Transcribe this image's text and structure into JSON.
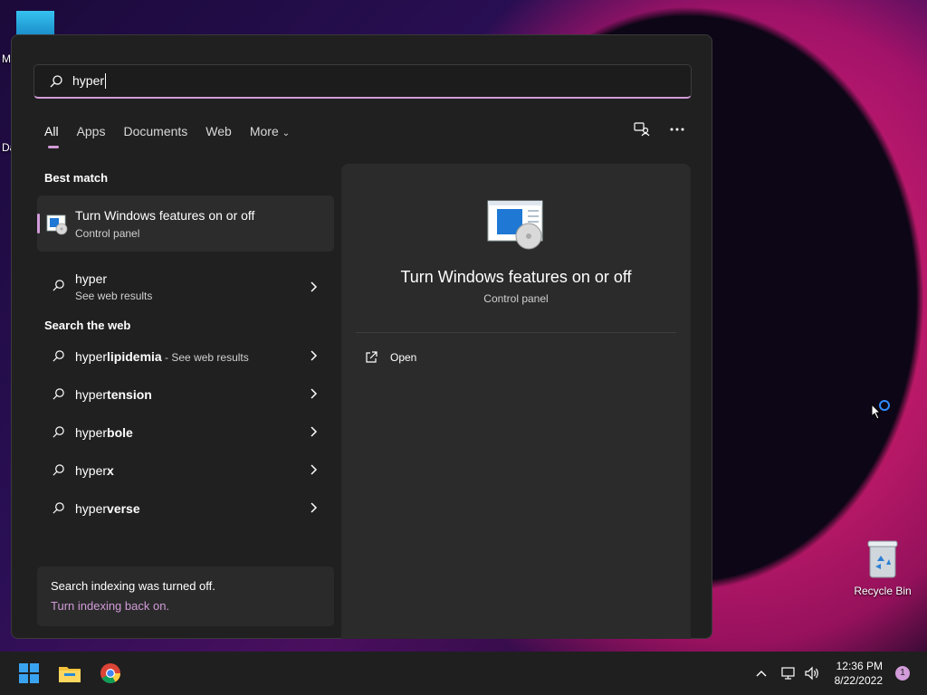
{
  "desktop": {
    "recycle_bin_label": "Recycle Bin",
    "partial_label_1": "M",
    "partial_label_2": "Da"
  },
  "search": {
    "query": "hyper"
  },
  "tabs": [
    {
      "label": "All",
      "active": true
    },
    {
      "label": "Apps"
    },
    {
      "label": "Documents"
    },
    {
      "label": "Web"
    },
    {
      "label": "More"
    }
  ],
  "left": {
    "best_match_title": "Best match",
    "best_match": {
      "title": "Turn Windows features on or off",
      "subtitle": "Control panel"
    },
    "web_result": {
      "title": "hyper",
      "subtitle": "See web results"
    },
    "search_web_title": "Search the web",
    "suggestions": [
      {
        "prefix": "hyper",
        "bold": "lipidemia",
        "suffix": " - See web results"
      },
      {
        "prefix": "hyper",
        "bold": "tension",
        "suffix": ""
      },
      {
        "prefix": "hyper",
        "bold": "bole",
        "suffix": ""
      },
      {
        "prefix": "hyper",
        "bold": "x",
        "suffix": ""
      },
      {
        "prefix": "hyper",
        "bold": "verse",
        "suffix": ""
      }
    ],
    "indexing": {
      "line1": "Search indexing was turned off.",
      "line2": "Turn indexing back on."
    }
  },
  "detail": {
    "title": "Turn Windows features on or off",
    "subtitle": "Control panel",
    "open_label": "Open"
  },
  "taskbar": {
    "time": "12:36 PM",
    "date": "8/22/2022",
    "notification_count": "1"
  },
  "colors": {
    "accent": "#d29bd9",
    "panel": "#202020"
  }
}
